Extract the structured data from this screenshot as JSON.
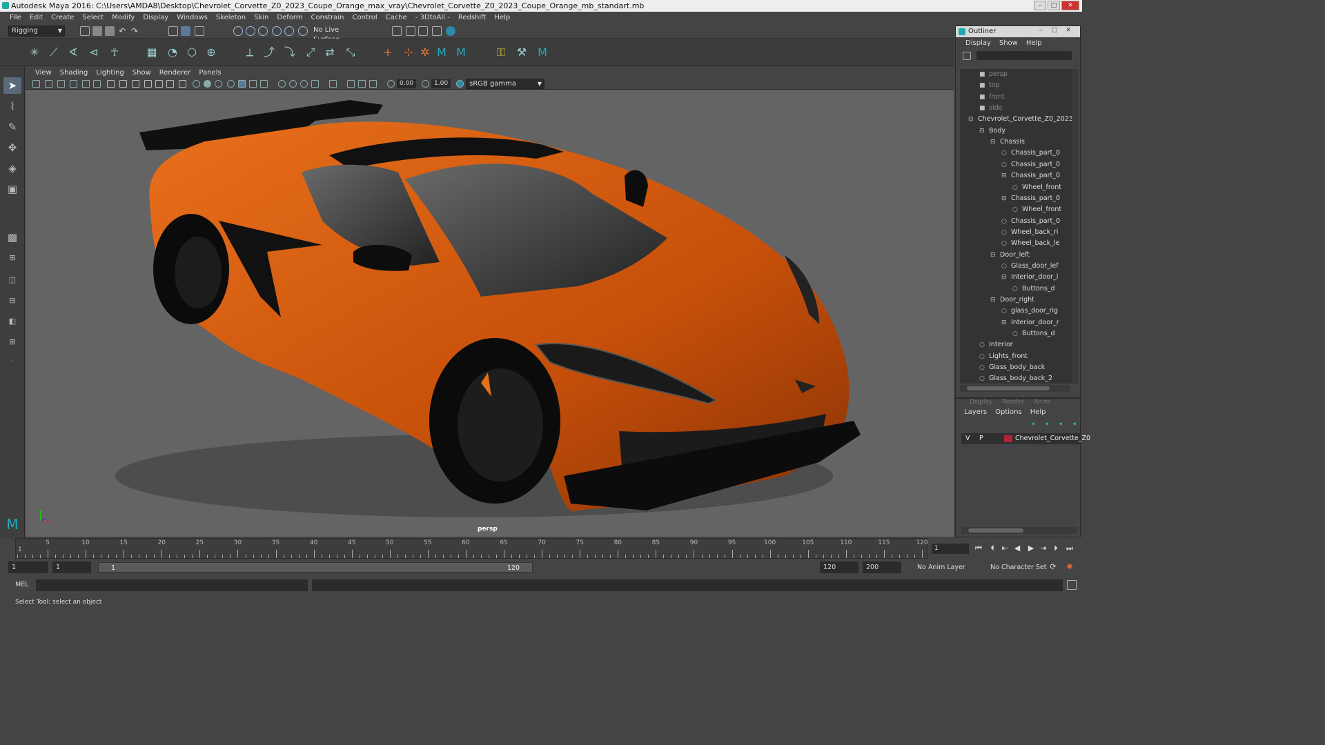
{
  "window": {
    "title": "Autodesk Maya 2016: C:\\Users\\AMDA8\\Desktop\\Chevrolet_Corvette_Z0_2023_Coupe_Orange_max_vray\\Chevrolet_Corvette_Z0_2023_Coupe_Orange_mb_standart.mb"
  },
  "menubar": [
    "File",
    "Edit",
    "Create",
    "Select",
    "Modify",
    "Display",
    "Windows",
    "Skeleton",
    "Skin",
    "Deform",
    "Constrain",
    "Control",
    "Cache",
    "- 3DtoAll -",
    "Redshift",
    "Help"
  ],
  "statusline": {
    "menuset": "Rigging",
    "live_surface": "No Live Surface"
  },
  "panel_menu": [
    "View",
    "Shading",
    "Lighting",
    "Show",
    "Renderer",
    "Panels"
  ],
  "panel_toolbar": {
    "field1": "0.00",
    "field2": "1.00",
    "colorspace": "sRGB gamma"
  },
  "viewport": {
    "camera": "persp",
    "body_color": "#d95e10"
  },
  "outliner": {
    "title": "Outliner",
    "menus": [
      "Display",
      "Show",
      "Help"
    ],
    "rows": [
      {
        "label": "persp",
        "depth": 2,
        "glyph": "■",
        "type": "camera"
      },
      {
        "label": "top",
        "depth": 2,
        "glyph": "■",
        "type": "camera"
      },
      {
        "label": "front",
        "depth": 2,
        "glyph": "■",
        "type": "camera"
      },
      {
        "label": "side",
        "depth": 2,
        "glyph": "■",
        "type": "camera"
      },
      {
        "label": "Chevrolet_Corvette_Z0_2023",
        "depth": 0,
        "glyph": "⊟",
        "type": "node"
      },
      {
        "label": "Body",
        "depth": 1,
        "glyph": "⊟",
        "type": "node"
      },
      {
        "label": "Chassis",
        "depth": 2,
        "glyph": "⊟",
        "type": "node"
      },
      {
        "label": "Chassis_part_0",
        "depth": 3,
        "glyph": "○",
        "type": "node"
      },
      {
        "label": "Chassis_part_0",
        "depth": 3,
        "glyph": "○",
        "type": "node"
      },
      {
        "label": "Chassis_part_0",
        "depth": 3,
        "glyph": "⊟",
        "type": "node"
      },
      {
        "label": "Wheel_front",
        "depth": 4,
        "glyph": "○",
        "type": "node"
      },
      {
        "label": "Chassis_part_0",
        "depth": 3,
        "glyph": "⊟",
        "type": "node"
      },
      {
        "label": "Wheel_front",
        "depth": 4,
        "glyph": "○",
        "type": "node"
      },
      {
        "label": "Chassis_part_0",
        "depth": 3,
        "glyph": "○",
        "type": "node"
      },
      {
        "label": "Wheel_back_ri",
        "depth": 3,
        "glyph": "○",
        "type": "node"
      },
      {
        "label": "Wheel_back_le",
        "depth": 3,
        "glyph": "○",
        "type": "node"
      },
      {
        "label": "Door_left",
        "depth": 2,
        "glyph": "⊟",
        "type": "node"
      },
      {
        "label": "Glass_door_lef",
        "depth": 3,
        "glyph": "○",
        "type": "node"
      },
      {
        "label": "Interior_door_l",
        "depth": 3,
        "glyph": "⊟",
        "type": "node"
      },
      {
        "label": "Buttons_d",
        "depth": 4,
        "glyph": "○",
        "type": "node"
      },
      {
        "label": "Door_right",
        "depth": 2,
        "glyph": "⊟",
        "type": "node"
      },
      {
        "label": "glass_door_rig",
        "depth": 3,
        "glyph": "○",
        "type": "node"
      },
      {
        "label": "Interior_door_r",
        "depth": 3,
        "glyph": "⊟",
        "type": "node"
      },
      {
        "label": "Buttons_d",
        "depth": 4,
        "glyph": "○",
        "type": "node"
      },
      {
        "label": "Interior",
        "depth": 1,
        "glyph": "○",
        "type": "node"
      },
      {
        "label": "Lights_front",
        "depth": 1,
        "glyph": "○",
        "type": "node"
      },
      {
        "label": "Glass_body_back",
        "depth": 1,
        "glyph": "○",
        "type": "node"
      },
      {
        "label": "Glass_body_back_2",
        "depth": 1,
        "glyph": "○",
        "type": "node"
      }
    ]
  },
  "layers": {
    "tabs": [
      "Display",
      "Render",
      "Anim"
    ],
    "menus": [
      "Layers",
      "Options",
      "Help"
    ],
    "row": {
      "v": "V",
      "p": "P",
      "name": "Chevrolet_Corvette_Z0",
      "color": "#b0243a"
    }
  },
  "timeline": {
    "ticks": [
      5,
      10,
      15,
      20,
      25,
      30,
      35,
      40,
      45,
      50,
      55,
      60,
      65,
      70,
      75,
      80,
      85,
      90,
      95,
      100,
      105,
      110,
      115,
      120
    ],
    "start_label": "1",
    "current_frame": "1"
  },
  "range": {
    "start": "1",
    "inner_start": "1",
    "range_start_label": "1",
    "range_end_label": "120",
    "end": "120",
    "end2": "200",
    "anim_layer": "No Anim Layer",
    "char_set": "No Character Set"
  },
  "cmdline": {
    "label": "MEL"
  },
  "helpline": {
    "text": "Select Tool: select an object"
  }
}
